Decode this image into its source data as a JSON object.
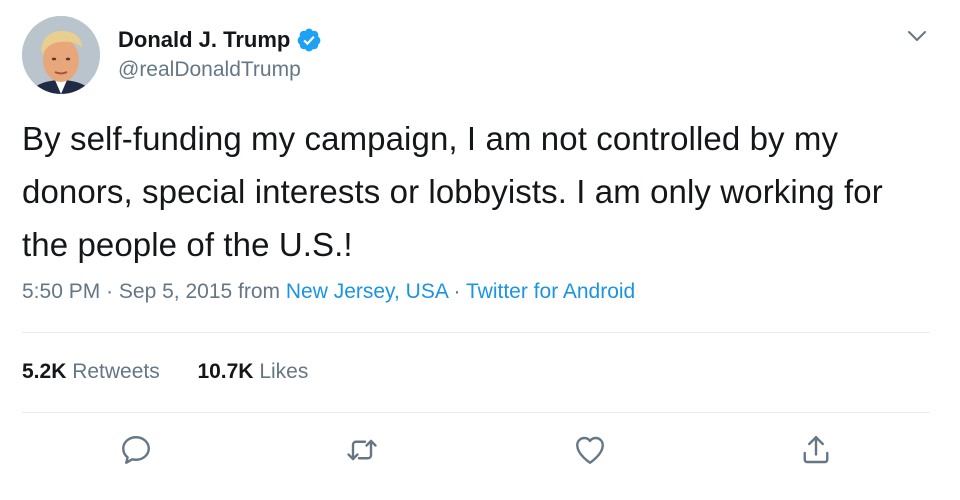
{
  "author": {
    "display_name": "Donald J. Trump",
    "handle": "@realDonaldTrump",
    "verified": true,
    "avatar_icon": "profile-photo"
  },
  "tweet": {
    "text": "By self-funding my campaign, I am not controlled by my donors, special interests or lobbyists. I am only working for the people of the U.S.!",
    "time": "5:50 PM",
    "separator": "·",
    "date": "Sep 5, 2015",
    "from_label": "from",
    "location": "New Jersey, USA",
    "source": "Twitter for Android"
  },
  "stats": {
    "retweets_count": "5.2K",
    "retweets_label": "Retweets",
    "likes_count": "10.7K",
    "likes_label": "Likes"
  },
  "actions": [
    {
      "name": "reply",
      "icon": "reply-icon"
    },
    {
      "name": "retweet",
      "icon": "retweet-icon"
    },
    {
      "name": "like",
      "icon": "heart-icon"
    },
    {
      "name": "share",
      "icon": "share-icon"
    }
  ],
  "colors": {
    "link": "#1b95e0",
    "verified": "#1da1f2",
    "muted": "#657786",
    "text": "#14171a",
    "divider": "#e6ecf0"
  }
}
